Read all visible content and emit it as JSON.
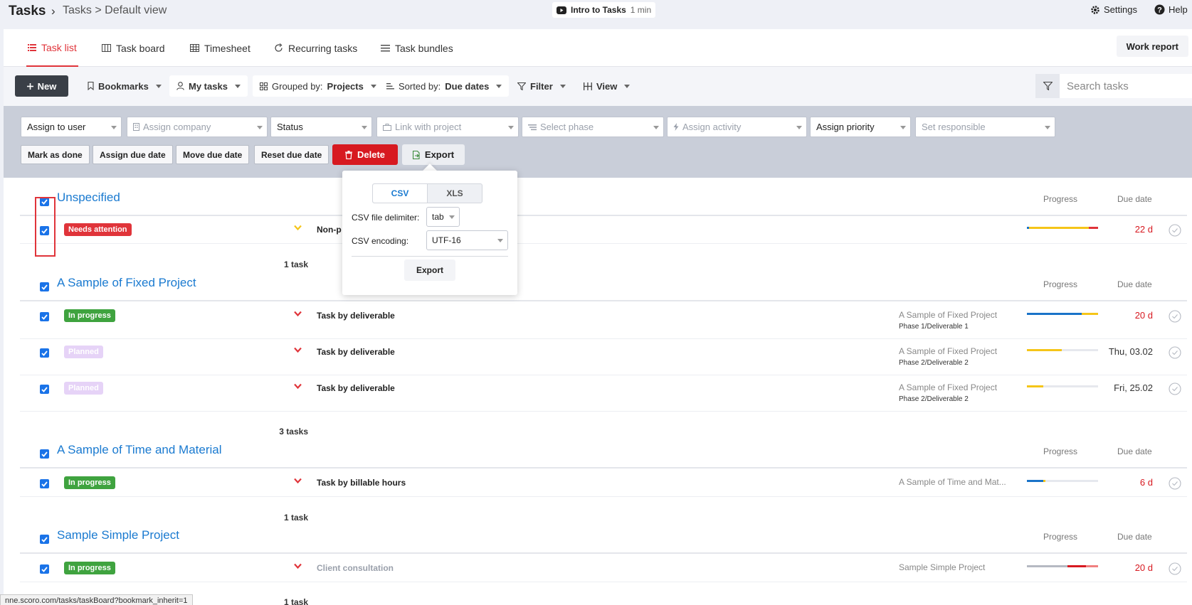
{
  "topbar": {
    "app_title": "Tasks",
    "breadcrumb": "Tasks > Default view",
    "intro_title": "Intro to Tasks",
    "intro_duration": "1 min",
    "settings_label": "Settings",
    "help_label": "Help"
  },
  "tabs": [
    {
      "label": "Task list",
      "active": true
    },
    {
      "label": "Task board"
    },
    {
      "label": "Timesheet"
    },
    {
      "label": "Recurring tasks"
    },
    {
      "label": "Task bundles"
    }
  ],
  "work_report_label": "Work report",
  "toolbar": {
    "new_label": "New",
    "bookmarks_label": "Bookmarks",
    "my_tasks_label": "My tasks",
    "grouped_prefix": "Grouped by:",
    "grouped_value": "Projects",
    "sorted_prefix": "Sorted by:",
    "sorted_value": "Due dates",
    "filter_label": "Filter",
    "view_label": "View",
    "search_placeholder": "Search tasks"
  },
  "bulk": {
    "selects": [
      "Assign to user",
      "Assign company",
      "Status",
      "Link with project",
      "Select phase",
      "Assign activity",
      "Assign priority",
      "Set responsible"
    ],
    "actions": [
      "Mark as done",
      "Assign due date",
      "Move due date",
      "Reset due date"
    ],
    "delete_label": "Delete",
    "export_label": "Export"
  },
  "export_popup": {
    "tab_csv": "CSV",
    "tab_xls": "XLS",
    "delimiter_label": "CSV file delimiter:",
    "delimiter_value": "tab",
    "encoding_label": "CSV encoding:",
    "encoding_value": "UTF-16",
    "export_label": "Export"
  },
  "columns": {
    "progress": "Progress",
    "due_date": "Due date"
  },
  "groups": [
    {
      "title": "Unspecified",
      "count": "1 task",
      "tasks": [
        {
          "status": "Needs attention",
          "name": "Non-p",
          "project": "",
          "phase": "",
          "due": "22 d"
        }
      ]
    },
    {
      "title": "A Sample of Fixed Project",
      "count": "3 tasks",
      "tasks": [
        {
          "status": "In progress",
          "name": "Task by deliverable",
          "project": "A Sample of Fixed Project",
          "phase": "Phase 1/Deliverable 1",
          "due": "20 d"
        },
        {
          "status": "Planned",
          "name": "Task by deliverable",
          "project": "A Sample of Fixed Project",
          "phase": "Phase 2/Deliverable 2",
          "due": "Thu, 03.02"
        },
        {
          "status": "Planned",
          "name": "Task by deliverable",
          "project": "A Sample of Fixed Project",
          "phase": "Phase 2/Deliverable 2",
          "due": "Fri, 25.02"
        }
      ]
    },
    {
      "title": "A Sample of Time and Material",
      "count": "1 task",
      "tasks": [
        {
          "status": "In progress",
          "name": "Task by billable hours",
          "project": "A Sample of Time and Mat...",
          "phase": "",
          "due": "6 d"
        }
      ]
    },
    {
      "title": "Sample Simple Project",
      "count": "1 task",
      "tasks": [
        {
          "status": "In progress",
          "name": "Client consultation",
          "project": "Sample Simple Project",
          "phase": "",
          "due": "20 d"
        }
      ]
    }
  ],
  "status_bar_url": "nne.scoro.com/tasks/taskBoard?bookmark_inherit=1",
  "colors": {
    "accent_red": "#e0343a",
    "link_blue": "#1a7ad0",
    "progress_blue": "#1a73c8",
    "progress_yellow": "#f5c518",
    "status_green": "#3fa33f"
  }
}
